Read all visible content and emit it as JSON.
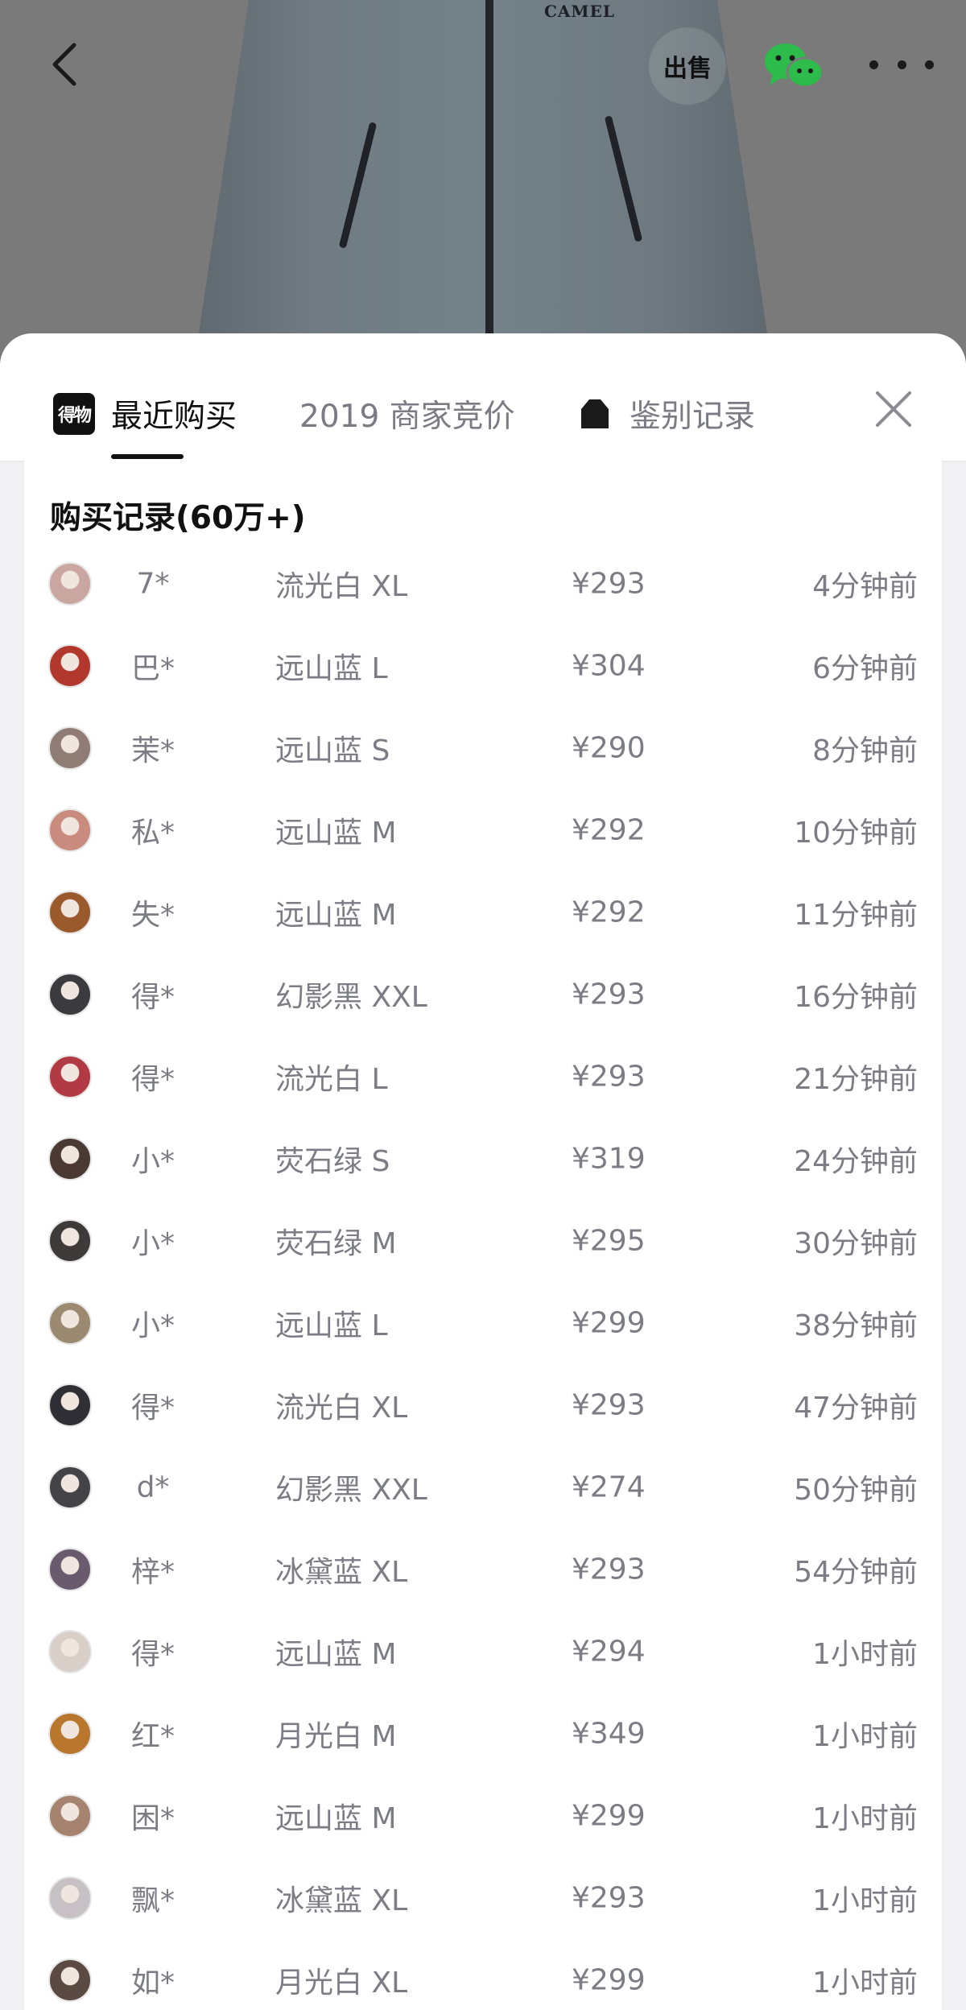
{
  "hero": {
    "brand_text": "CAMEL",
    "icons": {
      "back": "chevron-left-icon",
      "sell": "sell-icon",
      "wechat": "wechat-icon",
      "more": "more-dots-icon"
    },
    "sell_label": "出售"
  },
  "tabs": [
    {
      "label": "最近购买",
      "logo": "得物",
      "active": true
    },
    {
      "label": "2019 商家竞价",
      "active": false
    },
    {
      "label": "鉴别记录",
      "active": false
    }
  ],
  "records": {
    "title": "购买记录(60万+)",
    "items": [
      {
        "name": "7*",
        "spec": "流光白 XL",
        "price": "¥293",
        "time": "4分钟前",
        "avatar_color": "#c9a6a0"
      },
      {
        "name": "巴*",
        "spec": "远山蓝 L",
        "price": "¥304",
        "time": "6分钟前",
        "avatar_color": "#b2382e"
      },
      {
        "name": "茉*",
        "spec": "远山蓝 S",
        "price": "¥290",
        "time": "8分钟前",
        "avatar_color": "#8f7c75"
      },
      {
        "name": "私*",
        "spec": "远山蓝 M",
        "price": "¥292",
        "time": "10分钟前",
        "avatar_color": "#c98b7d"
      },
      {
        "name": "失*",
        "spec": "远山蓝 M",
        "price": "¥292",
        "time": "11分钟前",
        "avatar_color": "#9b5a2c"
      },
      {
        "name": "得*",
        "spec": "幻影黑 XXL",
        "price": "¥293",
        "time": "16分钟前",
        "avatar_color": "#3b3b3f"
      },
      {
        "name": "得*",
        "spec": "流光白 L",
        "price": "¥293",
        "time": "21分钟前",
        "avatar_color": "#b23a45"
      },
      {
        "name": "小*",
        "spec": "荧石绿 S",
        "price": "¥319",
        "time": "24分钟前",
        "avatar_color": "#4a3a33"
      },
      {
        "name": "小*",
        "spec": "荧石绿 M",
        "price": "¥295",
        "time": "30分钟前",
        "avatar_color": "#3f3a3a"
      },
      {
        "name": "小*",
        "spec": "远山蓝 L",
        "price": "¥299",
        "time": "38分钟前",
        "avatar_color": "#9c8a70"
      },
      {
        "name": "得*",
        "spec": "流光白 XL",
        "price": "¥293",
        "time": "47分钟前",
        "avatar_color": "#2f2f35"
      },
      {
        "name": "d*",
        "spec": "幻影黑 XXL",
        "price": "¥274",
        "time": "50分钟前",
        "avatar_color": "#444448"
      },
      {
        "name": "梓*",
        "spec": "冰黛蓝 XL",
        "price": "¥293",
        "time": "54分钟前",
        "avatar_color": "#6a5a6e"
      },
      {
        "name": "得*",
        "spec": "远山蓝 M",
        "price": "¥294",
        "time": "1小时前",
        "avatar_color": "#d8d0c8"
      },
      {
        "name": "红*",
        "spec": "月光白 M",
        "price": "¥349",
        "time": "1小时前",
        "avatar_color": "#b8772c"
      },
      {
        "name": "困*",
        "spec": "远山蓝 M",
        "price": "¥299",
        "time": "1小时前",
        "avatar_color": "#a5836e"
      },
      {
        "name": "飘*",
        "spec": "冰黛蓝 XL",
        "price": "¥293",
        "time": "1小时前",
        "avatar_color": "#c7c0c4"
      },
      {
        "name": "如*",
        "spec": "月光白 XL",
        "price": "¥299",
        "time": "1小时前",
        "avatar_color": "#5a4a42"
      }
    ]
  }
}
